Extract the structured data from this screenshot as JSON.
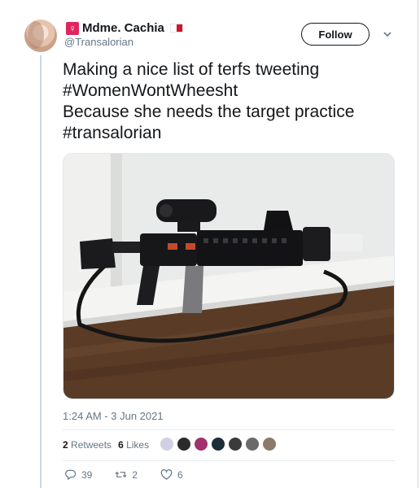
{
  "tweet": {
    "author": {
      "display_name": "Mdme. Cachia",
      "handle": "@Transalorian",
      "badge_icon": "venus-symbol-icon",
      "badge_glyph": "♀",
      "flag_icon": "malta-flag-icon"
    },
    "follow_label": "Follow",
    "text_lines": [
      "Making a nice list of terfs tweeting",
      "#WomenWontWheesht",
      "Because she needs the target practice",
      "#transalorian"
    ],
    "media": {
      "icon": "rifle-photo"
    },
    "timestamp": "1:24 AM - 3 Jun 2021",
    "stats": {
      "retweets_count": "2",
      "retweets_label": "Retweets",
      "likes_count": "6",
      "likes_label": "Likes"
    },
    "actions": {
      "reply_count": "39",
      "retweet_count": "2",
      "like_count": "6"
    },
    "colors": {
      "badge": "#e0245e",
      "secondary_text": "#657786",
      "flag_red": "#cf142b"
    }
  }
}
